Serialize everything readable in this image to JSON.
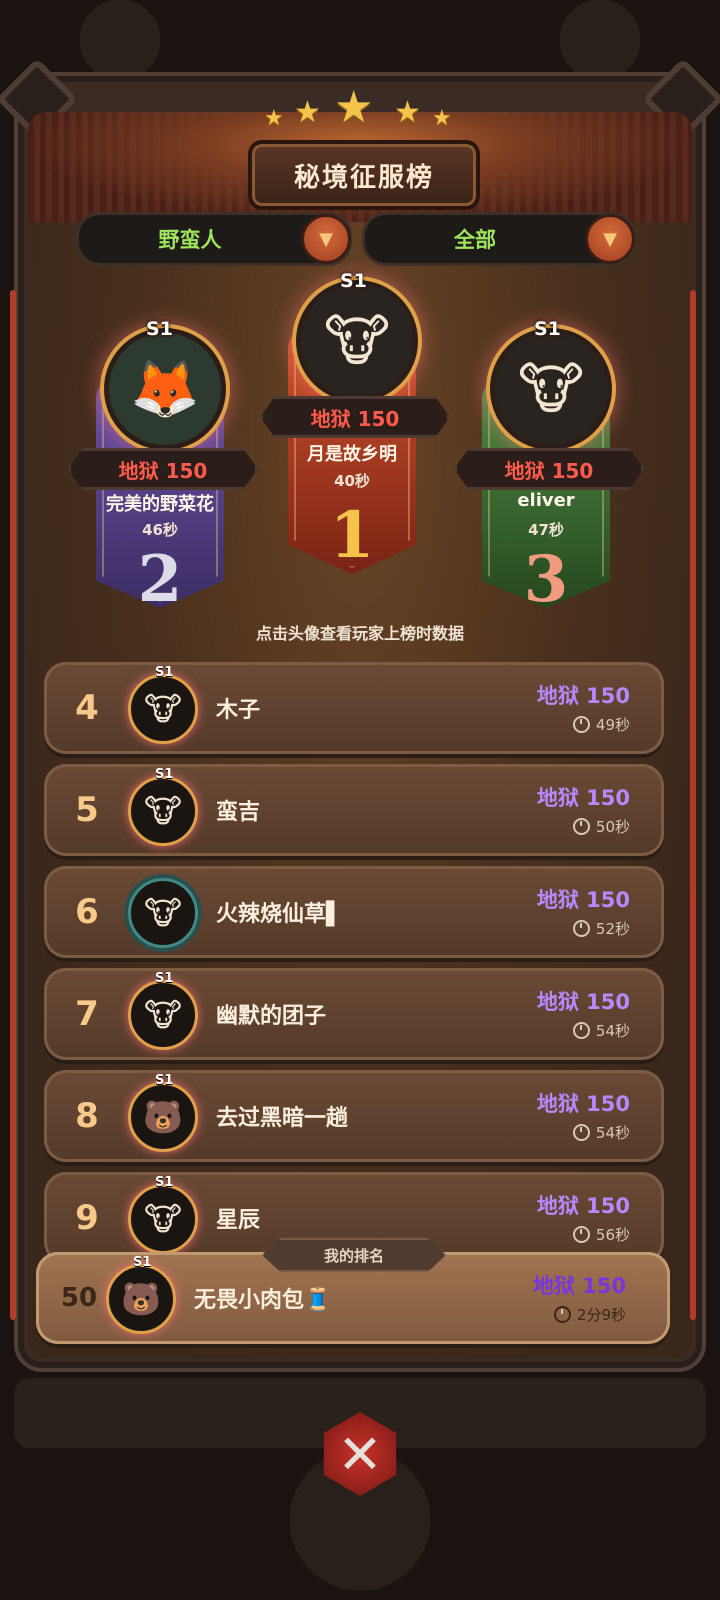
{
  "title": "秘境征服榜",
  "filters": {
    "class_label": "野蛮人",
    "scope_label": "全部"
  },
  "season_badge": "S1",
  "podium": [
    {
      "rank": "2",
      "name": "完美的野菜花",
      "difficulty": "地狱 150",
      "time": "46秒",
      "avatar_icon": "fox-avatar-icon",
      "color": "#6c52a8"
    },
    {
      "rank": "1",
      "name": "月是故乡明",
      "difficulty": "地狱 150",
      "time": "40秒",
      "avatar_icon": "cow-avatar-icon",
      "color": "#d0532d"
    },
    {
      "rank": "3",
      "name": "eliver",
      "difficulty": "地狱 150",
      "time": "47秒",
      "avatar_icon": "cow-avatar-icon",
      "color": "#4f8a45"
    }
  ],
  "hint": "点击头像查看玩家上榜时数据",
  "rows": [
    {
      "rank": "4",
      "name": "木子",
      "difficulty": "地狱 150",
      "time": "49秒",
      "avatar_icon": "cow-avatar-icon"
    },
    {
      "rank": "5",
      "name": "蛮吉",
      "difficulty": "地狱 150",
      "time": "50秒",
      "avatar_icon": "cow-avatar-icon"
    },
    {
      "rank": "6",
      "name": "火辣烧仙草▌",
      "difficulty": "地狱 150",
      "time": "52秒",
      "avatar_icon": "cow-avatar-icon"
    },
    {
      "rank": "7",
      "name": "幽默的团子",
      "difficulty": "地狱 150",
      "time": "54秒",
      "avatar_icon": "cow-avatar-icon"
    },
    {
      "rank": "8",
      "name": "去过黑暗一趟",
      "difficulty": "地狱 150",
      "time": "54秒",
      "avatar_icon": "bear-avatar-icon"
    },
    {
      "rank": "9",
      "name": "星辰",
      "difficulty": "地狱 150",
      "time": "56秒",
      "avatar_icon": "cow-avatar-icon"
    }
  ],
  "my_ranking": {
    "label": "我的排名",
    "rank": "50",
    "name": "无畏小肉包🧵",
    "difficulty": "地狱 150",
    "time": "2分9秒",
    "avatar_icon": "bear-avatar-icon"
  },
  "colors": {
    "difficulty_red": "#ff5b4c",
    "difficulty_purple": "#b689ff",
    "filter_green": "#9ee55c"
  }
}
